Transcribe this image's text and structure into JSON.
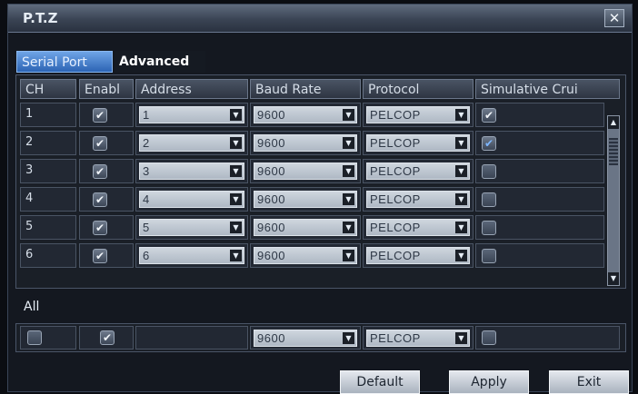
{
  "window": {
    "title": "P.T.Z",
    "close_glyph": "✕"
  },
  "tabs": [
    {
      "label": "Serial Port",
      "active": true
    },
    {
      "label": "Advanced",
      "active": false
    }
  ],
  "table": {
    "columns": [
      "CH",
      "Enabl",
      "Address",
      "Baud Rate",
      "Protocol",
      "Simulative Crui"
    ],
    "rows": [
      {
        "ch": "1",
        "enabled": true,
        "address": "1",
        "baud_rate": "9600",
        "protocol": "PELCOP",
        "simulative_cruise": true
      },
      {
        "ch": "2",
        "enabled": true,
        "address": "2",
        "baud_rate": "9600",
        "protocol": "PELCOP",
        "simulative_cruise": true
      },
      {
        "ch": "3",
        "enabled": true,
        "address": "3",
        "baud_rate": "9600",
        "protocol": "PELCOP",
        "simulative_cruise": false
      },
      {
        "ch": "4",
        "enabled": true,
        "address": "4",
        "baud_rate": "9600",
        "protocol": "PELCOP",
        "simulative_cruise": false
      },
      {
        "ch": "5",
        "enabled": true,
        "address": "5",
        "baud_rate": "9600",
        "protocol": "PELCOP",
        "simulative_cruise": false
      },
      {
        "ch": "6",
        "enabled": true,
        "address": "6",
        "baud_rate": "9600",
        "protocol": "PELCOP",
        "simulative_cruise": false
      }
    ]
  },
  "all_section": {
    "label": "All",
    "select_all": false,
    "enabled": true,
    "baud_rate": "9600",
    "protocol": "PELCOP",
    "simulative_cruise": false
  },
  "buttons": {
    "default": "Default",
    "apply": "Apply",
    "exit": "Exit"
  },
  "glyphs": {
    "check": "✔",
    "dropdown_arrow": "▼",
    "scroll_up": "▲",
    "scroll_down": "▼"
  },
  "colors": {
    "accent_tab": "#2c64b4",
    "dialog_bg": "#141820",
    "check_blue": "#7db6ff"
  }
}
